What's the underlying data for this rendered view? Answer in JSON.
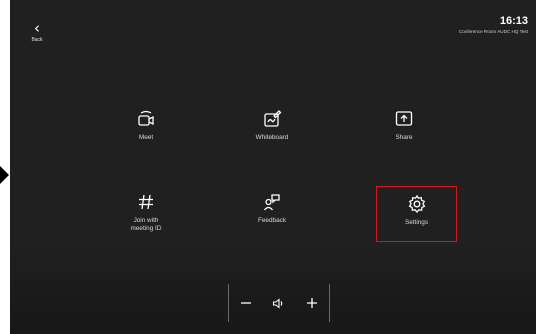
{
  "header": {
    "back_label": "Back",
    "time": "16:13",
    "room_name": "Conference Room AUDC HQ Test"
  },
  "tiles": [
    {
      "id": "meet",
      "label": "Meet",
      "icon": "meet-camera-icon"
    },
    {
      "id": "whiteboard",
      "label": "Whiteboard",
      "icon": "whiteboard-pen-icon"
    },
    {
      "id": "share",
      "label": "Share",
      "icon": "share-upload-icon"
    },
    {
      "id": "join",
      "label": "Join with\nmeeting ID",
      "icon": "hash-icon"
    },
    {
      "id": "feedback",
      "label": "Feedback",
      "icon": "feedback-person-icon"
    },
    {
      "id": "settings",
      "label": "Settings",
      "icon": "gear-icon",
      "selected": true
    }
  ],
  "volume": {
    "decrease_icon": "minus-icon",
    "speaker_icon": "speaker-icon",
    "increase_icon": "plus-icon"
  },
  "colors": {
    "background": "#202020",
    "highlight": "#d1171d",
    "text": "#ffffff"
  }
}
